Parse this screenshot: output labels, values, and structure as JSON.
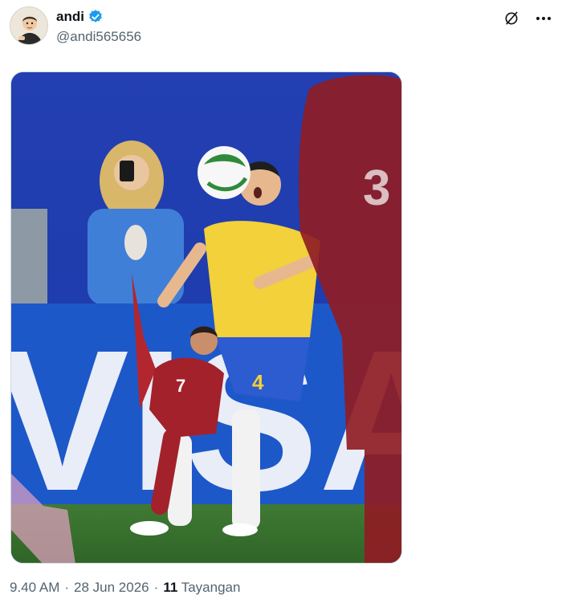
{
  "author": {
    "display_name": "andi",
    "handle": "@andi565656",
    "verified": true,
    "verified_color": "#1d9bf0"
  },
  "actions": {
    "grok_icon": "grok-icon",
    "more_icon": "more-icon"
  },
  "media": {
    "type": "photo",
    "jersey_numbers": {
      "attacker": "7",
      "defender": "4",
      "foreground_player": "3"
    },
    "ad_board_text": "VISA"
  },
  "meta": {
    "time": "9.40 AM",
    "separator": "·",
    "date": "28 Jun 2026",
    "views_count": "11",
    "views_label": "Tayangan"
  }
}
